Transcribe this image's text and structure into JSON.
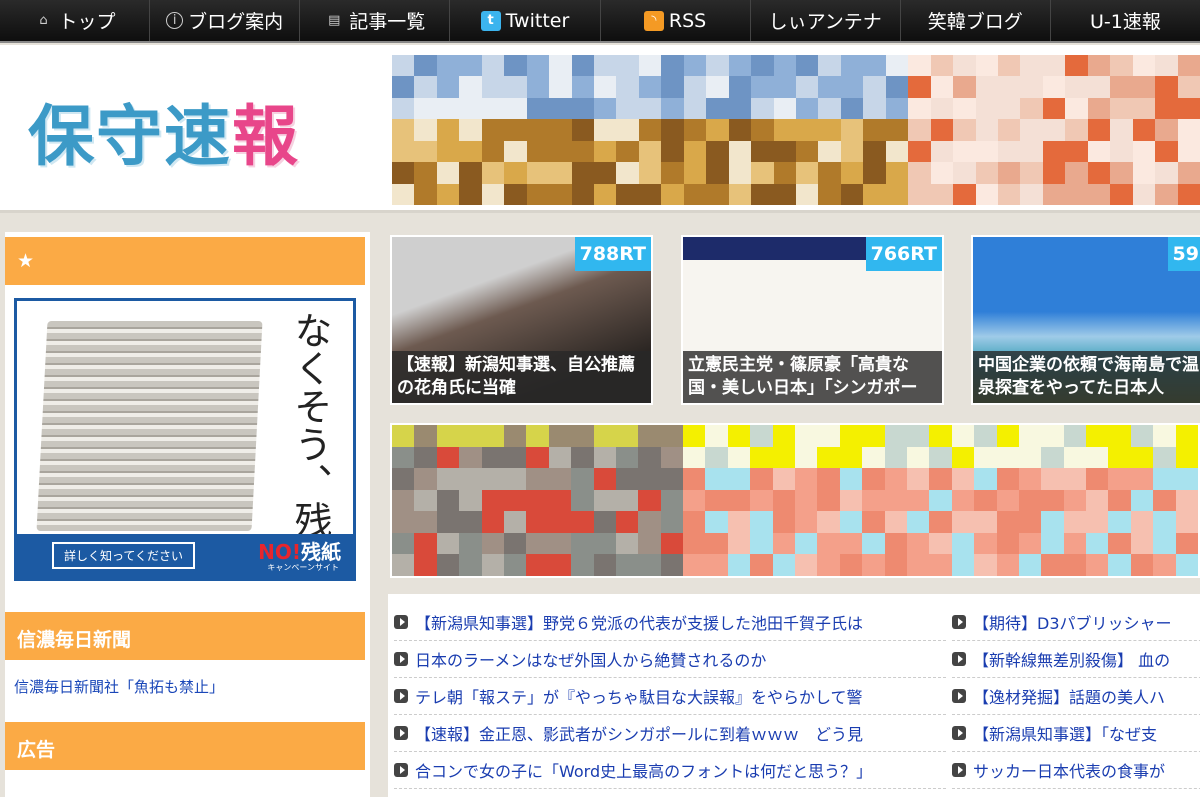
{
  "nav": [
    {
      "label": "トップ",
      "icon": "home-icon"
    },
    {
      "label": "ブログ案内",
      "icon": "info-icon"
    },
    {
      "label": "記事一覧",
      "icon": "document-icon"
    },
    {
      "label": "Twitter",
      "icon": "twitter-icon"
    },
    {
      "label": "RSS",
      "icon": "rss-icon"
    },
    {
      "label": "しぃアンテナ",
      "icon": ""
    },
    {
      "label": "笑韓ブログ",
      "icon": ""
    },
    {
      "label": "U-1速報",
      "icon": ""
    }
  ],
  "header": {
    "logo_main": "保守速",
    "logo_accent": "報"
  },
  "sidebar": {
    "star_header": "★",
    "ad": {
      "headline": "なくそう、残紙",
      "button": "詳しく知ってください",
      "brand_no": "NO!",
      "brand_text": "残紙",
      "brand_sub": "キャンペーンサイト"
    },
    "section1_header": "信濃毎日新聞",
    "section1_link": "信濃毎日新聞社「魚拓も禁止」",
    "section2_header": "広告"
  },
  "thumbs": [
    {
      "rt": "788RT",
      "caption": "【速報】新潟知事選、自公推薦の花角氏に当確"
    },
    {
      "rt": "766RT",
      "caption": "立憲民主党・篠原豪「高貴な国・美しい日本」「シンガポー"
    },
    {
      "rt": "59",
      "caption": "中国企業の依頼で海南島で温泉探査をやってた日本人"
    }
  ],
  "links_left": [
    "【新潟県知事選】野党６党派の代表が支援した池田千賀子氏は",
    "日本のラーメンはなぜ外国人から絶賛されるのか",
    "テレ朝「報ステ」が『やっちゃ駄目な大誤報』をやらかして警",
    "【速報】金正恩、影武者がシンガポールに到着ｗｗｗ　どう見",
    "合コンで女の子に「Word史上最高のフォントは何だと思う？」"
  ],
  "links_right": [
    "【期待】D3パブリッシャー",
    "【新幹線無差別殺傷】 血の",
    "【逸材発掘】話題の美人ハ",
    "【新潟県知事選】「なぜ支",
    "サッカー日本代表の食事が"
  ],
  "colors": {
    "accent_orange": "#fbaa45",
    "link_blue": "#1a3db0",
    "logo_blue": "#3c9ac7",
    "logo_pink": "#e8468a",
    "rt_badge": "#31b7ef"
  }
}
